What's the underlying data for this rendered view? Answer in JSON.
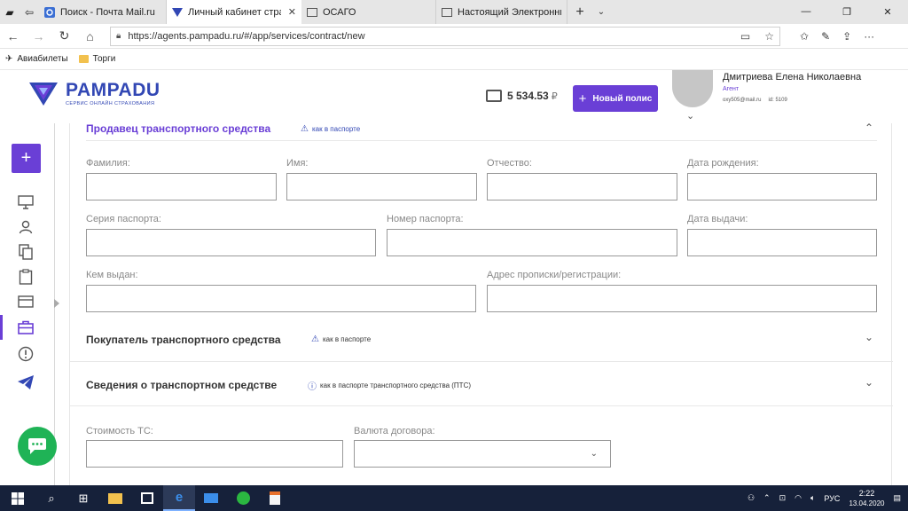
{
  "browser": {
    "tabs": [
      {
        "label": "Поиск - Почта Mail.ru",
        "active": false
      },
      {
        "label": "Личный кабинет страх",
        "active": true
      },
      {
        "label": "ОСАГО",
        "active": false
      },
      {
        "label": "Настоящий Электронный Г",
        "active": false
      }
    ],
    "url": "https://agents.pampadu.ru/#/app/services/contract/new",
    "bookmarks": [
      "Авиабилеты",
      "Торги"
    ]
  },
  "header": {
    "logo_name": "PAMPADU",
    "logo_tagline": "СЕРВИС ОНЛАЙН СТРАХОВАНИЯ",
    "balance": "5 534.53",
    "currency": "₽",
    "new_policy_label": "Новый полис",
    "user_name": "Дмитриева Елена Николаевна",
    "user_role": "Агент",
    "user_email": "oxy505@mail.ru",
    "user_id": "id: 5109"
  },
  "form": {
    "seller": {
      "title": "Продавец транспортного средства",
      "hint": "как в паспорте",
      "fields": {
        "last_name": "Фамилия:",
        "first_name": "Имя:",
        "patronymic": "Отчество:",
        "birth_date": "Дата рождения:",
        "passport_series": "Серия паспорта:",
        "passport_number": "Номер паспорта:",
        "issue_date": "Дата выдачи:",
        "issued_by": "Кем выдан:",
        "address": "Адрес прописки/регистрации:"
      }
    },
    "buyer": {
      "title": "Покупатель транспортного средства",
      "hint": "как в паспорте"
    },
    "vehicle": {
      "title": "Сведения о транспортном средстве",
      "hint": "как в паспорте транспортного средства (ПТС)"
    },
    "cost_label": "Стоимость ТС:",
    "currency_label": "Валюта договора:"
  },
  "taskbar": {
    "lang": "РУС",
    "time": "2:22",
    "date": "13.04.2020"
  },
  "colors": {
    "accent": "#6a3fd6",
    "brand": "#3247b4",
    "chat": "#1fb356"
  }
}
